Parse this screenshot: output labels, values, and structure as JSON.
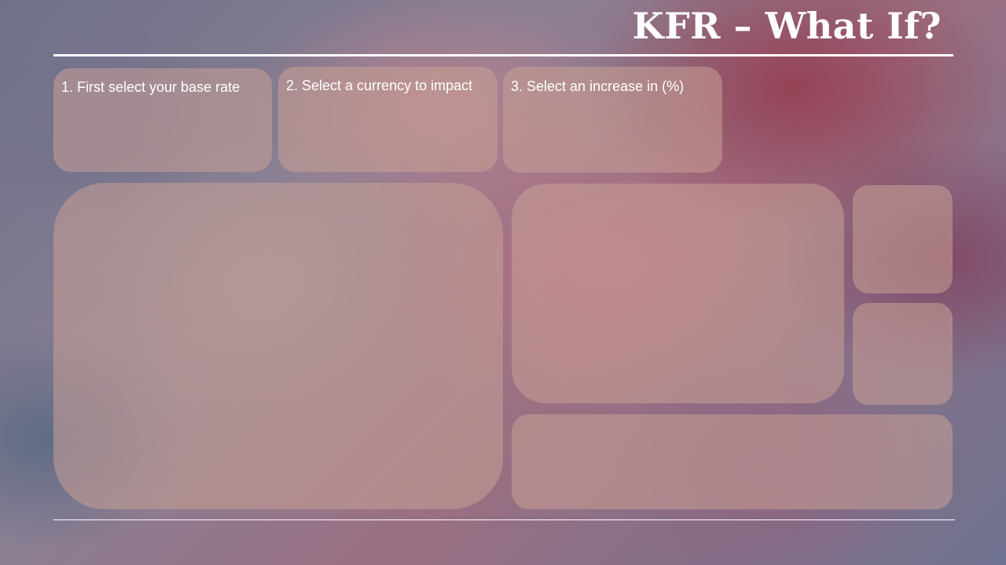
{
  "header": {
    "title": "KFR – What If?"
  },
  "slicers": [
    {
      "label": "1. First select your base rate"
    },
    {
      "label": "2. Select a currency to impact"
    },
    {
      "label": "3. Select an increase in (%)"
    }
  ],
  "colors": {
    "title": "#ffffff",
    "rule": "#ffffff",
    "panel_fill": "#c8a096"
  }
}
